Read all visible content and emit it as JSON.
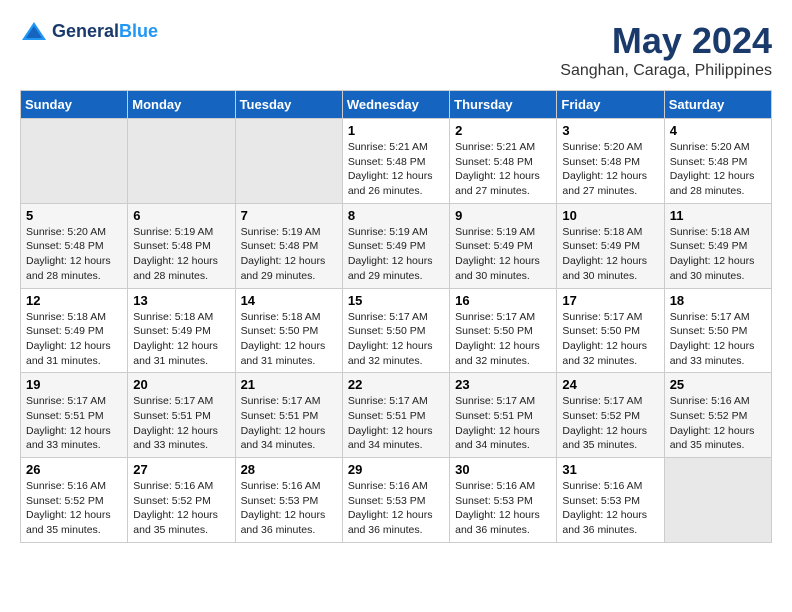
{
  "logo": {
    "line1": "General",
    "line2": "Blue"
  },
  "title": "May 2024",
  "location": "Sanghan, Caraga, Philippines",
  "days_header": [
    "Sunday",
    "Monday",
    "Tuesday",
    "Wednesday",
    "Thursday",
    "Friday",
    "Saturday"
  ],
  "weeks": [
    [
      {
        "day": "",
        "info": ""
      },
      {
        "day": "",
        "info": ""
      },
      {
        "day": "",
        "info": ""
      },
      {
        "day": "1",
        "info": "Sunrise: 5:21 AM\nSunset: 5:48 PM\nDaylight: 12 hours\nand 26 minutes."
      },
      {
        "day": "2",
        "info": "Sunrise: 5:21 AM\nSunset: 5:48 PM\nDaylight: 12 hours\nand 27 minutes."
      },
      {
        "day": "3",
        "info": "Sunrise: 5:20 AM\nSunset: 5:48 PM\nDaylight: 12 hours\nand 27 minutes."
      },
      {
        "day": "4",
        "info": "Sunrise: 5:20 AM\nSunset: 5:48 PM\nDaylight: 12 hours\nand 28 minutes."
      }
    ],
    [
      {
        "day": "5",
        "info": "Sunrise: 5:20 AM\nSunset: 5:48 PM\nDaylight: 12 hours\nand 28 minutes."
      },
      {
        "day": "6",
        "info": "Sunrise: 5:19 AM\nSunset: 5:48 PM\nDaylight: 12 hours\nand 28 minutes."
      },
      {
        "day": "7",
        "info": "Sunrise: 5:19 AM\nSunset: 5:48 PM\nDaylight: 12 hours\nand 29 minutes."
      },
      {
        "day": "8",
        "info": "Sunrise: 5:19 AM\nSunset: 5:49 PM\nDaylight: 12 hours\nand 29 minutes."
      },
      {
        "day": "9",
        "info": "Sunrise: 5:19 AM\nSunset: 5:49 PM\nDaylight: 12 hours\nand 30 minutes."
      },
      {
        "day": "10",
        "info": "Sunrise: 5:18 AM\nSunset: 5:49 PM\nDaylight: 12 hours\nand 30 minutes."
      },
      {
        "day": "11",
        "info": "Sunrise: 5:18 AM\nSunset: 5:49 PM\nDaylight: 12 hours\nand 30 minutes."
      }
    ],
    [
      {
        "day": "12",
        "info": "Sunrise: 5:18 AM\nSunset: 5:49 PM\nDaylight: 12 hours\nand 31 minutes."
      },
      {
        "day": "13",
        "info": "Sunrise: 5:18 AM\nSunset: 5:49 PM\nDaylight: 12 hours\nand 31 minutes."
      },
      {
        "day": "14",
        "info": "Sunrise: 5:18 AM\nSunset: 5:50 PM\nDaylight: 12 hours\nand 31 minutes."
      },
      {
        "day": "15",
        "info": "Sunrise: 5:17 AM\nSunset: 5:50 PM\nDaylight: 12 hours\nand 32 minutes."
      },
      {
        "day": "16",
        "info": "Sunrise: 5:17 AM\nSunset: 5:50 PM\nDaylight: 12 hours\nand 32 minutes."
      },
      {
        "day": "17",
        "info": "Sunrise: 5:17 AM\nSunset: 5:50 PM\nDaylight: 12 hours\nand 32 minutes."
      },
      {
        "day": "18",
        "info": "Sunrise: 5:17 AM\nSunset: 5:50 PM\nDaylight: 12 hours\nand 33 minutes."
      }
    ],
    [
      {
        "day": "19",
        "info": "Sunrise: 5:17 AM\nSunset: 5:51 PM\nDaylight: 12 hours\nand 33 minutes."
      },
      {
        "day": "20",
        "info": "Sunrise: 5:17 AM\nSunset: 5:51 PM\nDaylight: 12 hours\nand 33 minutes."
      },
      {
        "day": "21",
        "info": "Sunrise: 5:17 AM\nSunset: 5:51 PM\nDaylight: 12 hours\nand 34 minutes."
      },
      {
        "day": "22",
        "info": "Sunrise: 5:17 AM\nSunset: 5:51 PM\nDaylight: 12 hours\nand 34 minutes."
      },
      {
        "day": "23",
        "info": "Sunrise: 5:17 AM\nSunset: 5:51 PM\nDaylight: 12 hours\nand 34 minutes."
      },
      {
        "day": "24",
        "info": "Sunrise: 5:17 AM\nSunset: 5:52 PM\nDaylight: 12 hours\nand 35 minutes."
      },
      {
        "day": "25",
        "info": "Sunrise: 5:16 AM\nSunset: 5:52 PM\nDaylight: 12 hours\nand 35 minutes."
      }
    ],
    [
      {
        "day": "26",
        "info": "Sunrise: 5:16 AM\nSunset: 5:52 PM\nDaylight: 12 hours\nand 35 minutes."
      },
      {
        "day": "27",
        "info": "Sunrise: 5:16 AM\nSunset: 5:52 PM\nDaylight: 12 hours\nand 35 minutes."
      },
      {
        "day": "28",
        "info": "Sunrise: 5:16 AM\nSunset: 5:53 PM\nDaylight: 12 hours\nand 36 minutes."
      },
      {
        "day": "29",
        "info": "Sunrise: 5:16 AM\nSunset: 5:53 PM\nDaylight: 12 hours\nand 36 minutes."
      },
      {
        "day": "30",
        "info": "Sunrise: 5:16 AM\nSunset: 5:53 PM\nDaylight: 12 hours\nand 36 minutes."
      },
      {
        "day": "31",
        "info": "Sunrise: 5:16 AM\nSunset: 5:53 PM\nDaylight: 12 hours\nand 36 minutes."
      },
      {
        "day": "",
        "info": ""
      }
    ]
  ]
}
